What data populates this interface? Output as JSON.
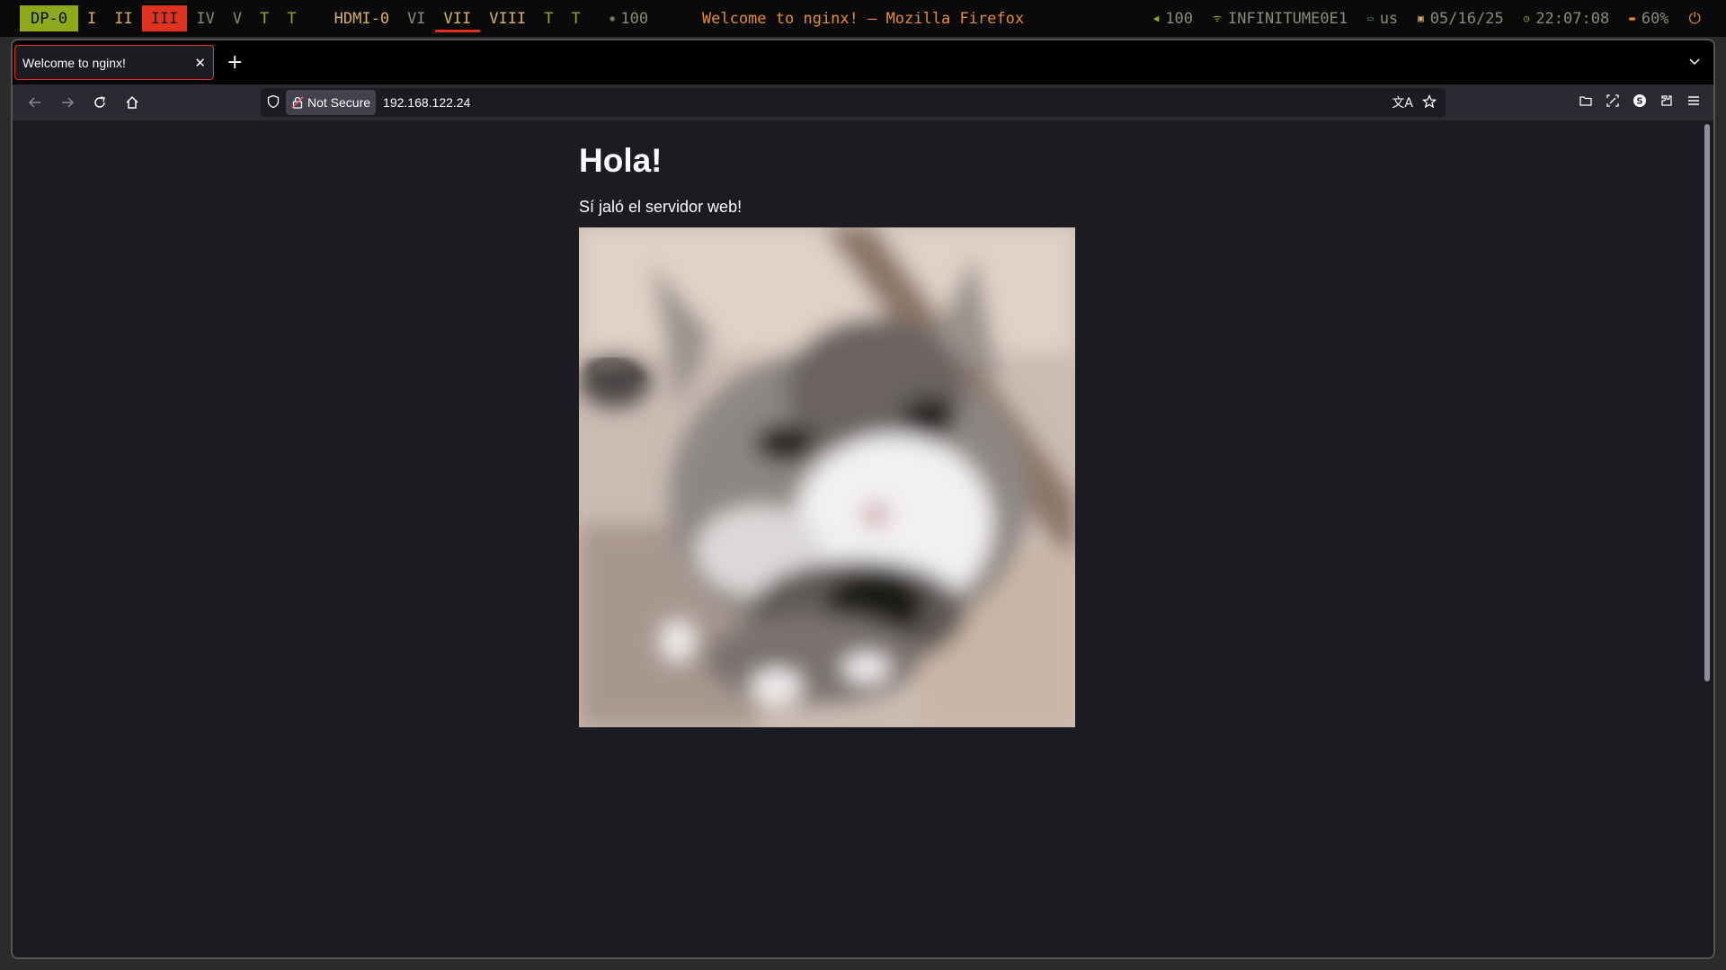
{
  "topbar": {
    "workspaces_dp": {
      "output": "DP-0",
      "items": [
        "I",
        "II",
        "III",
        "IV",
        "V",
        "T",
        "T"
      ]
    },
    "workspaces_hdmi": {
      "output": "HDMI-0",
      "items": [
        "VI",
        "VII",
        "VIII",
        "T",
        "T"
      ]
    },
    "brightness": "100",
    "window_title": "Welcome to nginx! — Mozilla Firefox",
    "volume": "100",
    "wifi": "INFINITUME0E1",
    "keyboard": "us",
    "date": "05/16/25",
    "time": "22:07:08",
    "battery": "60%",
    "colors": {
      "accent_green": "#8fa91d",
      "urgent_red": "#e0331f",
      "title_orange": "#e68b2e",
      "label_gold": "#d7af5f"
    }
  },
  "browser": {
    "tab": {
      "title": "Welcome to nginx!",
      "close_icon": "close-icon"
    },
    "security_label": "Not Secure",
    "url": "192.168.122.24"
  },
  "page": {
    "heading": "Hola!",
    "paragraph": "Sí jaló el servidor web!",
    "image": "cat-photo"
  }
}
